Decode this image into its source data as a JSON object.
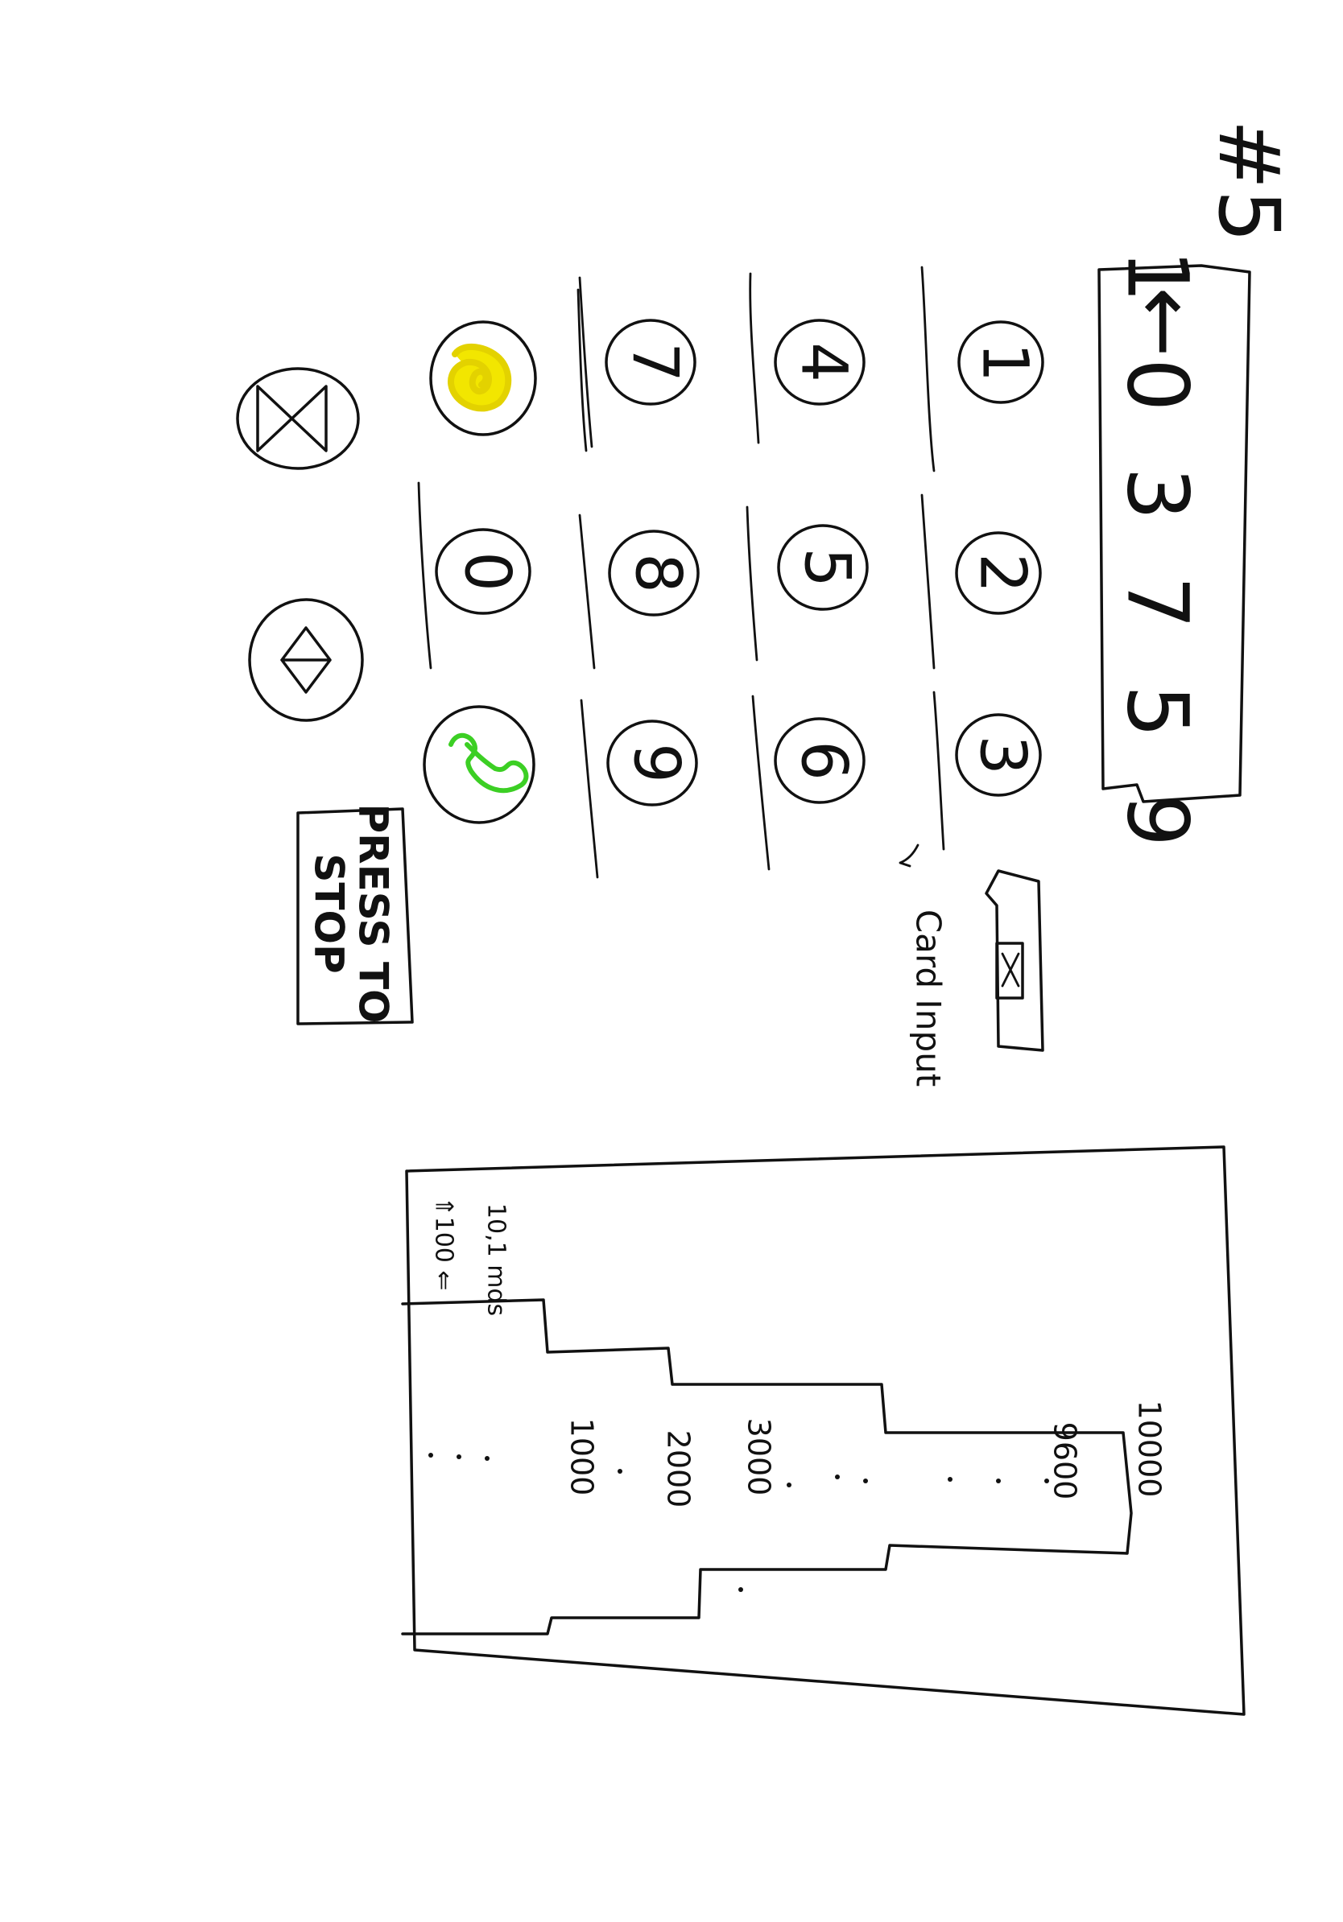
{
  "page": {
    "number": "#5"
  },
  "display": {
    "value": "1 0 3 7 5 9",
    "arrow": "←"
  },
  "keypad": {
    "keys": [
      {
        "label": "1"
      },
      {
        "label": "2"
      },
      {
        "label": "3"
      },
      {
        "label": "4"
      },
      {
        "label": "5"
      },
      {
        "label": "6"
      },
      {
        "label": "7"
      },
      {
        "label": "8"
      },
      {
        "label": "9"
      },
      {
        "label": "0"
      }
    ],
    "clear_icon": "yellow-scribble-icon",
    "call_icon": "phone-icon",
    "mute_icon": "bowtie-icon",
    "speaker_icon": "triangles-icon"
  },
  "card_input": {
    "label": "Card Input",
    "slot_icon": "x-icon"
  },
  "stop_button": {
    "label_line1": "PRESS TO",
    "label_line2": "STOP"
  },
  "colors": {
    "ink": "#111111",
    "clear_fill": "#f2e600",
    "call_stroke": "#3ccf24",
    "paper": "#ffffff"
  },
  "chart_data": {
    "type": "histogram",
    "labels": [
      "10,1 mds",
      "100",
      "1000",
      "2000",
      "3000",
      "9600",
      "10000"
    ],
    "annotation": "⇑100 ⇐"
  }
}
